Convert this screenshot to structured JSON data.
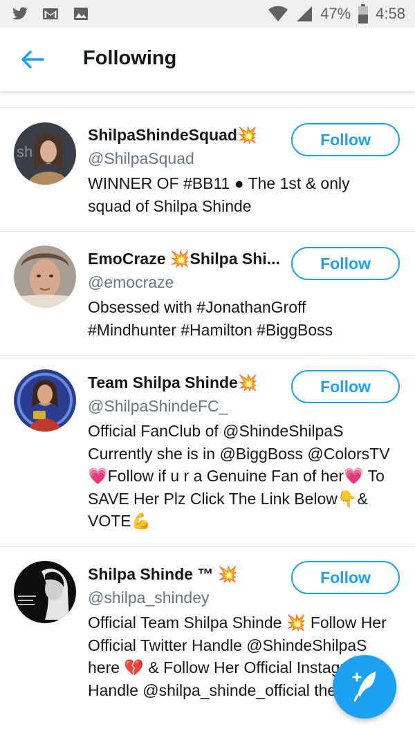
{
  "status_bar": {
    "battery": "47%",
    "time": "4:58",
    "icons": [
      "twitter-icon",
      "gmail-icon",
      "image-icon",
      "wifi-icon",
      "signal-icon",
      "battery-icon"
    ]
  },
  "header": {
    "title": "Following"
  },
  "accounts": [
    {
      "name": "ShilpaShindeSquad💥",
      "handle": "@ShilpaSquad",
      "bio": "WINNER OF #BB11 ● The 1st & only squad of Shilpa Shinde",
      "button": "Follow"
    },
    {
      "name": "EmoCraze 💥Shilpa Shi...",
      "handle": "@emocraze",
      "bio": "Obsessed with #JonathanGroff #Mindhunter #Hamilton #BiggBoss",
      "button": "Follow"
    },
    {
      "name": "Team Shilpa Shinde💥",
      "handle": "@ShilpaShindeFC_",
      "bio": "Official FanClub of @ShindeShilpaS Currently she is in @BiggBoss @ColorsTV 💗Follow if u r a Genuine Fan of her💗 To SAVE Her Plz Click The Link Below👇& VOTE💪",
      "button": "Follow"
    },
    {
      "name": "Shilpa Shinde ™ 💥",
      "handle": "@shilpa_shindey",
      "bio": "Official Team Shilpa Shinde 💥 Follow Her Official Twitter Handle @ShindeShilpaS here 💔 & Follow Her Official Instagram Handle @shilpa_shinde_official there 💗",
      "button": "Follow"
    }
  ],
  "colors": {
    "accent": "#1da1f2",
    "text": "#14171a",
    "secondary": "#657786"
  }
}
